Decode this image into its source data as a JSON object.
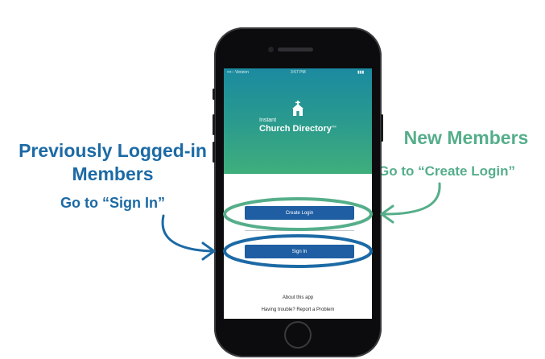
{
  "callouts": {
    "previous_title_line1": "Previously Logged-in",
    "previous_title_line2": "Members",
    "previous_instruction": "Go to “Sign In”",
    "new_title": "New Members",
    "new_instruction": "Go to “Create Login”"
  },
  "status_bar": {
    "carrier": "•••◦◦ Verizon",
    "time": "3:57 PM",
    "battery": "▮▮▮"
  },
  "app": {
    "brand_small": "Instant",
    "brand_name": "Church Directory",
    "brand_mark": "TM",
    "create_login_label": "Create Login",
    "sign_in_label": "Sign In",
    "about_link": "About this app",
    "trouble_text": "Having trouble? Report a Problem"
  },
  "colors": {
    "blue_accent": "#1c6aa5",
    "green_accent": "#55ae8a",
    "button_blue": "#1f5ea3",
    "hero_top": "#1b8aa0",
    "hero_bottom": "#3fae7c"
  },
  "icons": {
    "logo": "church-icon"
  }
}
